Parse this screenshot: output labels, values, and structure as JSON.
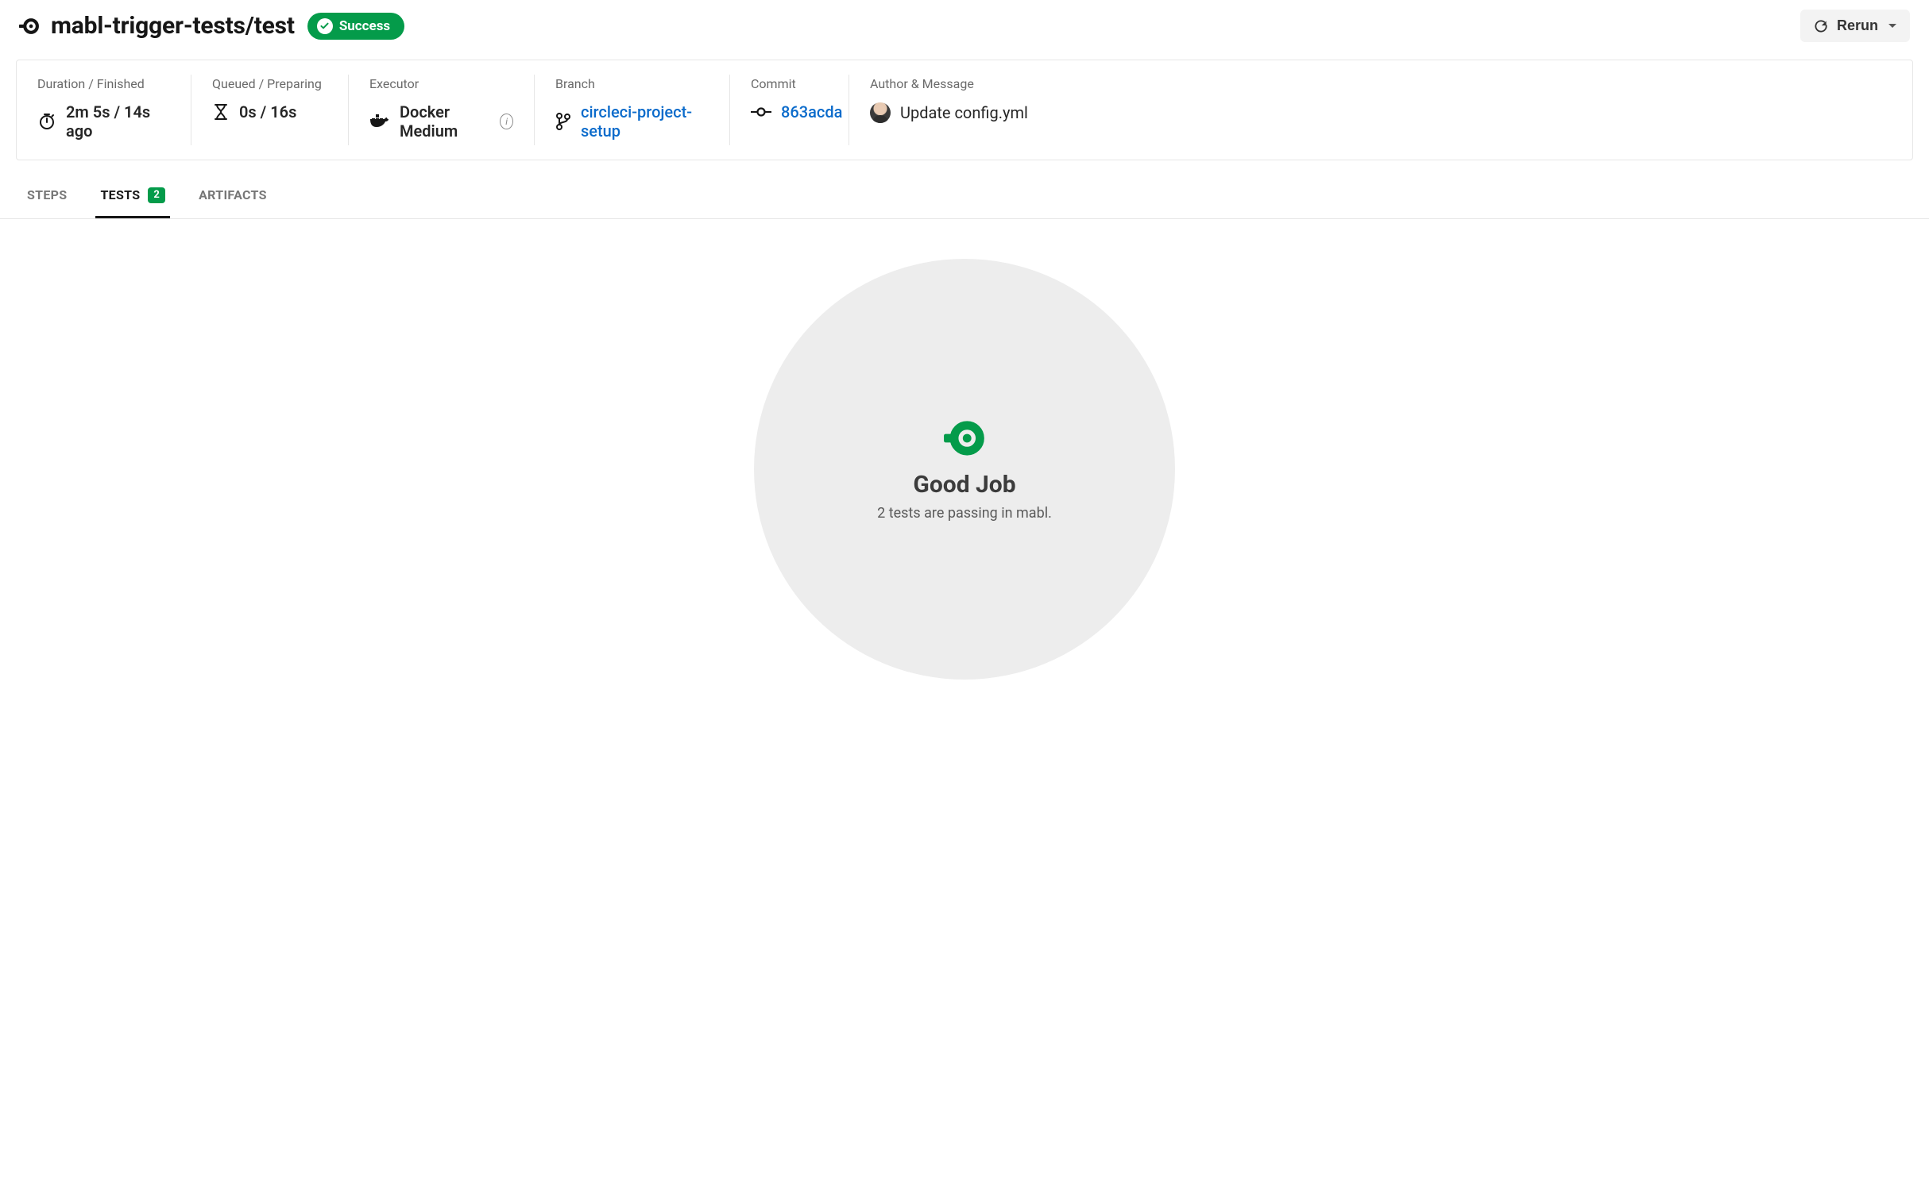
{
  "header": {
    "title": "mabl-trigger-tests/test",
    "status_label": "Success",
    "rerun_label": "Rerun"
  },
  "info": {
    "duration": {
      "label": "Duration / Finished",
      "value": "2m 5s / 14s ago"
    },
    "queued": {
      "label": "Queued / Preparing",
      "value": "0s / 16s"
    },
    "executor": {
      "label": "Executor",
      "value": "Docker Medium"
    },
    "branch": {
      "label": "Branch",
      "link": "circleci-project-setup"
    },
    "commit": {
      "label": "Commit",
      "link": "863acda"
    },
    "author": {
      "label": "Author & Message",
      "message": "Update config.yml"
    }
  },
  "tabs": {
    "steps": {
      "label": "STEPS"
    },
    "tests": {
      "label": "TESTS",
      "badge": "2"
    },
    "artifacts": {
      "label": "ARTIFACTS"
    }
  },
  "result": {
    "title": "Good Job",
    "subtitle": "2 tests are passing in mabl."
  }
}
